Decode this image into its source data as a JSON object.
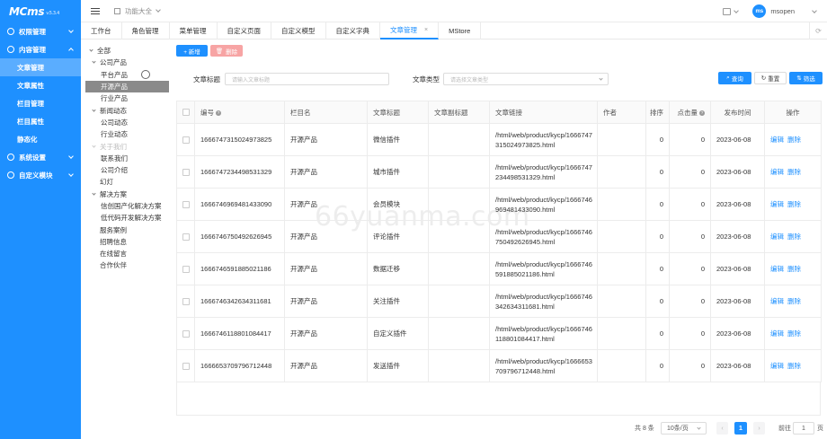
{
  "app": {
    "logo": "MCms",
    "version": "v.5.3.4"
  },
  "sidebar": {
    "items": [
      {
        "label": "权限管理",
        "type": "group",
        "expanded": false
      },
      {
        "label": "内容管理",
        "type": "group",
        "expanded": true
      },
      {
        "label": "文章管理",
        "type": "sub",
        "active": true
      },
      {
        "label": "文章属性",
        "type": "sub"
      },
      {
        "label": "栏目管理",
        "type": "sub"
      },
      {
        "label": "栏目属性",
        "type": "sub"
      },
      {
        "label": "静态化",
        "type": "sub"
      },
      {
        "label": "系统设置",
        "type": "group",
        "expanded": false
      },
      {
        "label": "自定义模块",
        "type": "group",
        "expanded": false
      }
    ]
  },
  "header": {
    "menu_label": "功能大全",
    "avatar_text": "ms",
    "username": "msopen"
  },
  "tabs": [
    {
      "label": "工作台"
    },
    {
      "label": "角色管理"
    },
    {
      "label": "菜单管理"
    },
    {
      "label": "自定义页面"
    },
    {
      "label": "自定义模型"
    },
    {
      "label": "自定义字典"
    },
    {
      "label": "文章管理",
      "active": true,
      "close": "×"
    },
    {
      "label": "MStore"
    }
  ],
  "tree": [
    {
      "label": "全部",
      "indent": 0,
      "caret": true
    },
    {
      "label": "公司产品",
      "indent": 1,
      "caret": true
    },
    {
      "label": "平台产品",
      "indent": 2
    },
    {
      "label": "开源产品",
      "indent": 2,
      "selected": true
    },
    {
      "label": "行业产品",
      "indent": 2
    },
    {
      "label": "新闻动态",
      "indent": 1,
      "caret": true
    },
    {
      "label": "公司动态",
      "indent": 2
    },
    {
      "label": "行业动态",
      "indent": 2
    },
    {
      "label": "关于我们",
      "indent": 1,
      "caret": true,
      "dim": true
    },
    {
      "label": "联系我们",
      "indent": 2
    },
    {
      "label": "公司介绍",
      "indent": 2
    },
    {
      "label": "幻灯",
      "indent": 1
    },
    {
      "label": "解决方案",
      "indent": 1,
      "caret": true
    },
    {
      "label": "信创国产化解决方案",
      "indent": 2
    },
    {
      "label": "低代码开发解决方案",
      "indent": 2
    },
    {
      "label": "服务案例",
      "indent": 1
    },
    {
      "label": "招聘信息",
      "indent": 1
    },
    {
      "label": "在线留言",
      "indent": 1
    },
    {
      "label": "合作伙伴",
      "indent": 1
    }
  ],
  "toolbar": {
    "add_label": "+ 新增",
    "delete_label": "删除"
  },
  "filter": {
    "title_label": "文章标题",
    "title_placeholder": "请输入文章标题",
    "type_label": "文章类型",
    "type_placeholder": "请选择文章类型",
    "search_label": "查询",
    "reset_label": "重置",
    "filter_label": "筛选"
  },
  "table": {
    "headers": [
      "编号",
      "栏目名",
      "文章标题",
      "文章副标题",
      "文章链接",
      "作者",
      "排序",
      "点击量",
      "发布时间",
      "操作"
    ],
    "edit_label": "编辑",
    "delete_label": "删除",
    "rows": [
      {
        "id": "1666747315024973825",
        "category": "开源产品",
        "title": "微信插件",
        "subtitle": "",
        "link": "/html/web/product/kycp/1666747315024973825.html",
        "author": "",
        "sort": "0",
        "hits": "0",
        "date": "2023-06-08"
      },
      {
        "id": "1666747234498531329",
        "category": "开源产品",
        "title": "城市插件",
        "subtitle": "",
        "link": "/html/web/product/kycp/1666747234498531329.html",
        "author": "",
        "sort": "0",
        "hits": "0",
        "date": "2023-06-08"
      },
      {
        "id": "1666746969481433090",
        "category": "开源产品",
        "title": "会员模块",
        "subtitle": "",
        "link": "/html/web/product/kycp/1666746969481433090.html",
        "author": "",
        "sort": "0",
        "hits": "0",
        "date": "2023-06-08"
      },
      {
        "id": "1666746750492626945",
        "category": "开源产品",
        "title": "评论插件",
        "subtitle": "",
        "link": "/html/web/product/kycp/1666746750492626945.html",
        "author": "",
        "sort": "0",
        "hits": "0",
        "date": "2023-06-08"
      },
      {
        "id": "1666746591885021186",
        "category": "开源产品",
        "title": "数据迁移",
        "subtitle": "",
        "link": "/html/web/product/kycp/1666746591885021186.html",
        "author": "",
        "sort": "0",
        "hits": "0",
        "date": "2023-06-08"
      },
      {
        "id": "1666746342634311681",
        "category": "开源产品",
        "title": "关注插件",
        "subtitle": "",
        "link": "/html/web/product/kycp/1666746342634311681.html",
        "author": "",
        "sort": "0",
        "hits": "0",
        "date": "2023-06-08"
      },
      {
        "id": "1666746118801084417",
        "category": "开源产品",
        "title": "自定义插件",
        "subtitle": "",
        "link": "/html/web/product/kycp/1666746118801084417.html",
        "author": "",
        "sort": "0",
        "hits": "0",
        "date": "2023-06-08"
      },
      {
        "id": "1666653709796712448",
        "category": "开源产品",
        "title": "发送插件",
        "subtitle": "",
        "link": "/html/web/product/kycp/1666653709796712448.html",
        "author": "",
        "sort": "0",
        "hits": "0",
        "date": "2023-06-08"
      }
    ]
  },
  "pager": {
    "total": "共 8 条",
    "size": "10条/页",
    "prev": "‹",
    "current": "1",
    "next": "›",
    "goto_label": "前往",
    "page_input": "1",
    "unit": "页"
  },
  "watermark": "66yuanma.com"
}
